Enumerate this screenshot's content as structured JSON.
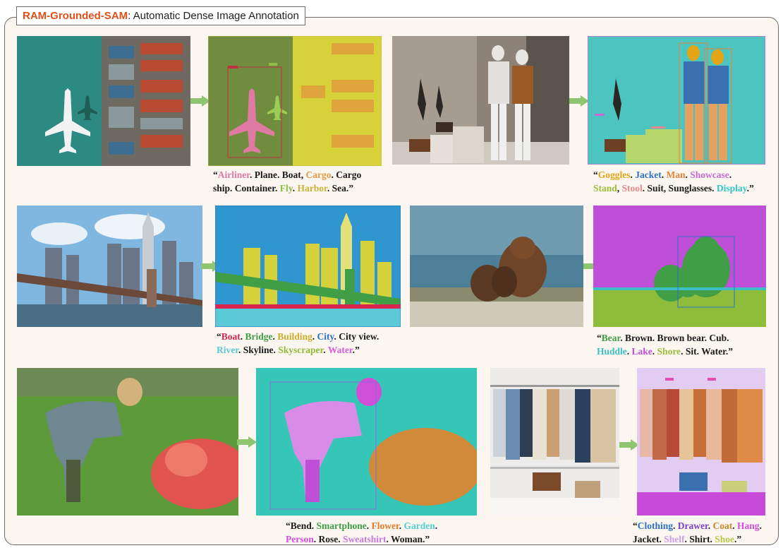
{
  "title": {
    "brand": "RAM-Grounded-SAM",
    "rest": ": Automatic Dense Image Annotation"
  },
  "colors": {
    "arrow": "#8fc56e",
    "frame": "#6b6b6b",
    "brand": "#e2501b"
  },
  "captions": [
    {
      "open": "“",
      "close": ".”",
      "tokens": [
        {
          "t": "Airliner",
          "c": "#e07aa4"
        },
        {
          "t": ". Plane. Boat, ",
          "c": ""
        },
        {
          "t": "Cargo",
          "c": "#e79a45"
        },
        {
          "t": ". Cargo",
          "c": ""
        },
        {
          "t": "BR",
          "c": ""
        },
        {
          "t": "ship. Container. ",
          "c": ""
        },
        {
          "t": "Fly",
          "c": "#8fbd48"
        },
        {
          "t": ". ",
          "c": ""
        },
        {
          "t": "Harbor",
          "c": "#c9b33a"
        },
        {
          "t": ". Sea",
          "c": ""
        }
      ]
    },
    {
      "open": "“",
      "close": ".”",
      "tokens": [
        {
          "t": "Goggles",
          "c": "#e3a416"
        },
        {
          "t": ". ",
          "c": ""
        },
        {
          "t": "Jacket",
          "c": "#2f73c8"
        },
        {
          "t": ". ",
          "c": ""
        },
        {
          "t": "Man",
          "c": "#e8823a"
        },
        {
          "t": ". ",
          "c": ""
        },
        {
          "t": "Showcase",
          "c": "#c66bd6"
        },
        {
          "t": ".",
          "c": ""
        },
        {
          "t": "BR",
          "c": ""
        },
        {
          "t": "Stand",
          "c": "#9bbd3c"
        },
        {
          "t": ", ",
          "c": ""
        },
        {
          "t": "Stool",
          "c": "#e9868e"
        },
        {
          "t": ". Suit, Sunglasses. ",
          "c": ""
        },
        {
          "t": "Display",
          "c": "#33c6c6"
        }
      ]
    },
    {
      "open": "“",
      "close": ".”",
      "tokens": [
        {
          "t": "Boat",
          "c": "#d9274f"
        },
        {
          "t": ". ",
          "c": ""
        },
        {
          "t": "Bridge",
          "c": "#3f9e46"
        },
        {
          "t": ". ",
          "c": ""
        },
        {
          "t": "Building",
          "c": "#c9ad2c"
        },
        {
          "t": ". ",
          "c": ""
        },
        {
          "t": "City",
          "c": "#2d6fc4"
        },
        {
          "t": ". City view.",
          "c": ""
        },
        {
          "t": "BR",
          "c": ""
        },
        {
          "t": "River",
          "c": "#5cc9d6"
        },
        {
          "t": ". Skyline. ",
          "c": ""
        },
        {
          "t": "Skyscraper",
          "c": "#93ba3a"
        },
        {
          "t": ". ",
          "c": ""
        },
        {
          "t": "Water",
          "c": "#d25fe0"
        }
      ]
    },
    {
      "open": "“",
      "close": ".”",
      "tokens": [
        {
          "t": "Bear",
          "c": "#3f9e46"
        },
        {
          "t": ". Brown. Brown bear. Cub.",
          "c": ""
        },
        {
          "t": "BR",
          "c": ""
        },
        {
          "t": "Huddle",
          "c": "#3cbfc4"
        },
        {
          "t": ". ",
          "c": ""
        },
        {
          "t": "Lake",
          "c": "#c04fd8"
        },
        {
          "t": ". ",
          "c": ""
        },
        {
          "t": "Shore",
          "c": "#9dbb3b"
        },
        {
          "t": ". Sit. Water",
          "c": ""
        }
      ]
    },
    {
      "open": "“",
      "close": ".”",
      "tokens": [
        {
          "t": "Bend",
          "c": ""
        },
        {
          "t": ". ",
          "c": ""
        },
        {
          "t": "Smartphone",
          "c": "#3f9e46"
        },
        {
          "t": ". ",
          "c": ""
        },
        {
          "t": "Flower",
          "c": "#e77a26"
        },
        {
          "t": ". ",
          "c": ""
        },
        {
          "t": "Garden",
          "c": "#4dd0d0"
        },
        {
          "t": ".",
          "c": ""
        },
        {
          "t": "BR",
          "c": ""
        },
        {
          "t": "Person",
          "c": "#d04fd8"
        },
        {
          "t": ". Rose. ",
          "c": ""
        },
        {
          "t": "Sweatshirt",
          "c": "#c77be0"
        },
        {
          "t": ". Woman",
          "c": ""
        }
      ]
    },
    {
      "open": "“",
      "close": ".”",
      "tokens": [
        {
          "t": "Clothing",
          "c": "#2d6fc4"
        },
        {
          "t": ". ",
          "c": ""
        },
        {
          "t": "Drawer",
          "c": "#7a3fc4"
        },
        {
          "t": ". ",
          "c": ""
        },
        {
          "t": "Coat",
          "c": "#c9862c"
        },
        {
          "t": ". ",
          "c": ""
        },
        {
          "t": "Hang",
          "c": "#d04fd8"
        },
        {
          "t": ".",
          "c": ""
        },
        {
          "t": "BR",
          "c": ""
        },
        {
          "t": "Jacket. ",
          "c": ""
        },
        {
          "t": "Shelf",
          "c": "#c9a0e8"
        },
        {
          "t": ". Shirt. ",
          "c": ""
        },
        {
          "t": "Shoe",
          "c": "#b7c94a"
        }
      ]
    }
  ]
}
